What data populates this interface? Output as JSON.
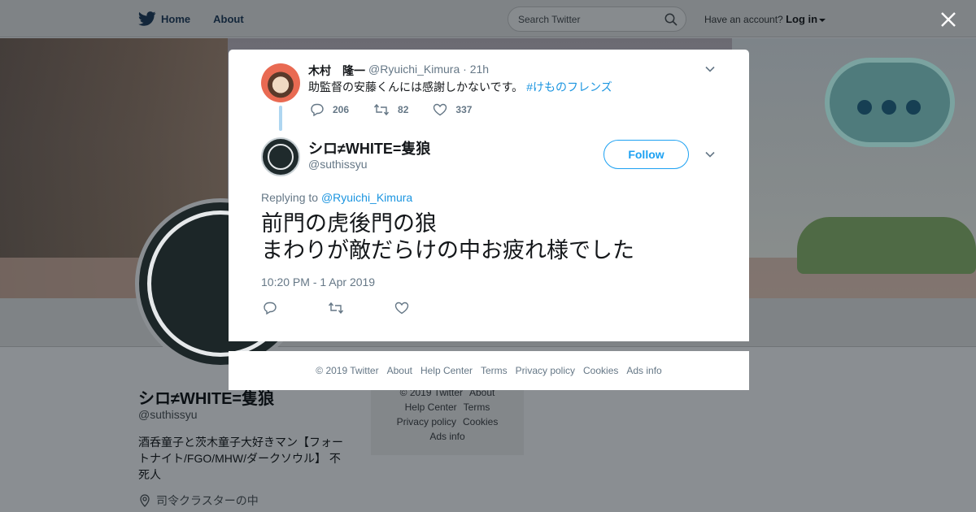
{
  "nav": {
    "home_label": "Home",
    "about_label": "About",
    "search_placeholder": "Search Twitter",
    "account_prompt": "Have an account?",
    "login_label": "Log in"
  },
  "background_profile": {
    "name": "シロ≠WHITE=隻狼",
    "handle": "@suthissyu",
    "bio": "酒呑童子と茨木童子大好きマン【フォートナイト/FGO/MHW/ダークソウル】 不死人",
    "location": "司令クラスターの中",
    "footer_links": [
      "© 2019 Twitter",
      "About",
      "Help Center",
      "Terms",
      "Privacy policy",
      "Cookies",
      "Ads info"
    ]
  },
  "parent_tweet": {
    "author_name": "木村　隆一",
    "meta": "@Ryuichi_Kimura · 21h",
    "text": "助監督の安藤くんには感謝しかないです。",
    "hashtag": "#けものフレンズ",
    "reply_count": "206",
    "retweet_count": "82",
    "like_count": "337"
  },
  "main_tweet": {
    "author_name": "シロ≠WHITE=隻狼",
    "author_handle": "@suthissyu",
    "follow_label": "Follow",
    "replying_prefix": "Replying to",
    "replying_handle": "@Ryuichi_Kimura",
    "text_line1": "前門の虎後門の狼",
    "text_line2": "まわりが敵だらけの中お疲れ様でした",
    "timestamp": "10:20 PM - 1 Apr 2019"
  },
  "footer": {
    "links": [
      "© 2019 Twitter",
      "About",
      "Help Center",
      "Terms",
      "Privacy policy",
      "Cookies",
      "Ads info"
    ]
  },
  "icons": {
    "brand": "twitter-bird-icon",
    "close": "close-icon",
    "search": "search-icon"
  },
  "colors": {
    "accent": "#1da1f2",
    "link": "#1b95e0",
    "muted": "#657786",
    "overlay": "#8a8e92"
  }
}
